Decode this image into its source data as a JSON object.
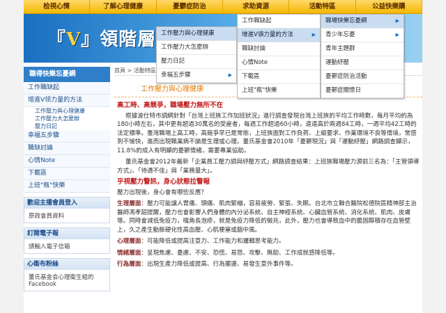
{
  "topnav": [
    "检視心情",
    "了解心理健康",
    "憂鬱症防治",
    "求助資源",
    "活動特區",
    "公益快樂購"
  ],
  "banner": {
    "text": "領階層",
    "accent": "#1a6fc0"
  },
  "sidebar": {
    "title": "職得快樂忘憂網",
    "items": [
      "工作職缺起",
      "增進V领力量的方法"
    ],
    "sub": [
      "工作壓力與心理健康",
      "工作壓力大怎麼辦",
      "壓力日記"
    ],
    "items2": [
      "幸福五步驟",
      "職缺討論",
      "心情Note",
      "下載區",
      "上班\"瓶\"快樂"
    ],
    "boxes": [
      {
        "title": "歡迎主播會員登入",
        "body": "原政會員資料"
      },
      {
        "title": "訂閱電子報",
        "body": "請輸入電子信箱"
      },
      {
        "title": "心衛布粉絲",
        "body": "董氏基金会心理衛生組的 Facebook"
      }
    ]
  },
  "crumb": "首頁 > 活動特區 >",
  "heading": "工作壓力與心理健康",
  "article": {
    "h1": "高工時、高競爭，職場壓力無所不在",
    "p1": "根據波仕特市調網針對「台灣上班族工作加班狀況」進行調查發現台灣上班族的平均工作時數，每月平均約為180小時左右，其中更有超過30萬名的受雇者，每週工作超過60小時，遠遠高於兩週84工時，一週平均42工時的法定標準。臺灣職場上高工時，高競爭早已是常態，上班族面對工作負荷、上級要求、作業環境不良等情境，常感到不愉快，進而出現職業病不論是生理或心理。董氏基金會2010年「憂鬱現況」與「運動紓壓」網路調查顯示，11.8%的成人有明顯的憂鬱情緒，需要專業協助。",
    "p2": "董氏基金會2012年最新「企業員工壓力調與紓壓方式」網路調查結果：上班族職場壓力源前三名為：「主管領導方式」、「待遇不佳」與「業務量大」。",
    "h2": "乎視壓力警訊，身心狀態拉警報",
    "p3": "壓力出現後，身心會有哪些反應？",
    "l1": "生理層面",
    "t1": "：壓力可能讓人胃痛、頭痛、肌肉緊繃，容易疲勞、緊張、失眠。台北市立聯合醫院松德院區精神部主治醫師馮孝韶提醒，壓力也會影響人們身體的內分泌系統、自主神經系統、心臟血管系統、消化系統、肌肉、皮膚等。同時會減低免疫力，嘴角長泡疹，就是免疫力降低的徵兆，此外，壓力也會導致血中的膽固醇積存在血管壁上，久之產生動脈硬化性高血壓、心肌梗塞或腦中風。",
    "l2": "心理層面",
    "t2": "：可能降低或提高注意力、工作能力和邏輯思考能力。",
    "l3": "情緒層面",
    "t3": "：呈現焦慮、憂慮、不安、恐慌、易怒、攻擊、無助、工作成就感降低等。",
    "l4": "行為層面",
    "t4": "：出現生產力降低或提高、行為擺盪、易發生意外事件等。"
  },
  "menu": {
    "col1": [
      "工作壓力與心理健康",
      "工作壓力大怎麼辦",
      "壓力日記",
      "幸福五步驟"
    ],
    "col2": [
      "工作職缺起",
      "增進V領力量的方法",
      "職缺討論",
      "心情Note",
      "下載區",
      "上班\"瓶\"快樂"
    ],
    "col3": [
      "職場快樂忘憂網",
      "青少年忘憂",
      "青年主題群",
      "運動紓壓",
      "憂鬱症防治活動",
      "憂鬱症關懷日"
    ]
  }
}
